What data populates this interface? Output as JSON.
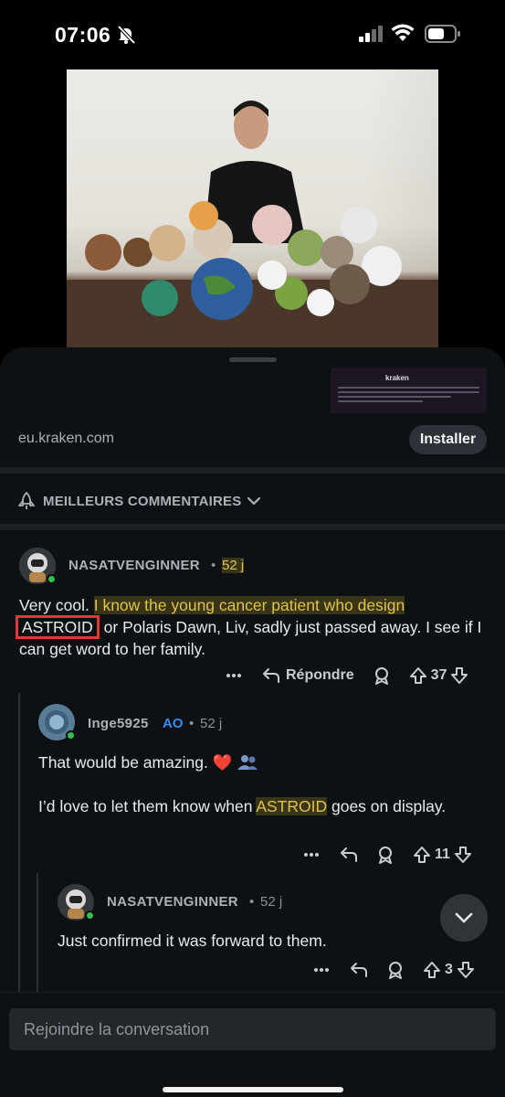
{
  "status_bar": {
    "time": "07:06",
    "icons": [
      "bell-slash-icon",
      "signal-icon",
      "wifi-icon",
      "battery-icon"
    ]
  },
  "ad": {
    "brand_logo_text": "kraken",
    "domain": "eu.kraken.com",
    "install_label": "Installer"
  },
  "sort": {
    "label": "MEILLEURS COMMENTAIRES",
    "icon": "rocket-icon"
  },
  "comments": [
    {
      "username": "NASATVENGINNER",
      "age": "52 j",
      "body_parts": [
        "Very cool. ",
        "I know the young cancer patient who design",
        "ASTROID",
        " or Polaris Dawn, Liv, sadly just passed away. I see if I can get word to her family."
      ],
      "reply_label": "Répondre",
      "votes": "37"
    },
    {
      "username": "Inge5925",
      "op_tag": "AO",
      "age": "52 j",
      "body_line1": "That would be amazing. ❤️",
      "body_parts2": [
        "I’d love to let them know when ",
        "ASTROID",
        " goes on display."
      ],
      "votes": "11"
    },
    {
      "username": "NASATVENGINNER",
      "age": "52 j",
      "body": "Just confirmed it was forward to them.",
      "votes": "3"
    }
  ],
  "composer": {
    "placeholder": "Rejoindre la conversation"
  },
  "colors": {
    "background": "#0e1114",
    "highlight": "#e0c34a",
    "box": "#e03a34",
    "op": "#3a8bf0",
    "online": "#2fbf4a"
  }
}
